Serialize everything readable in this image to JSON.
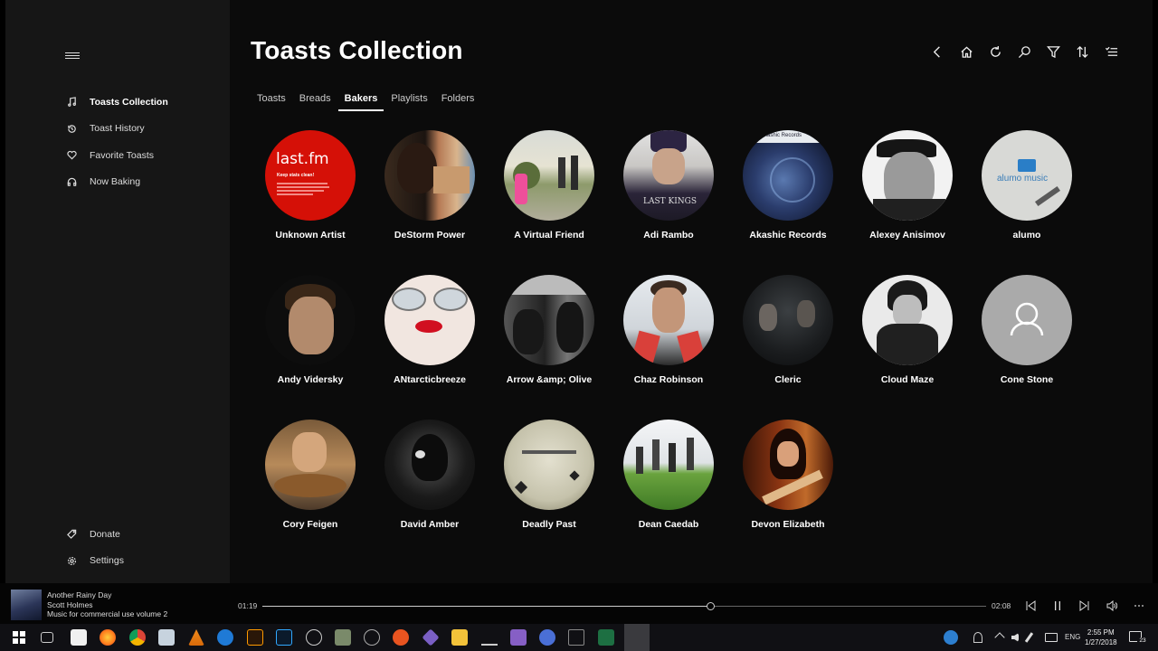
{
  "sidebar": {
    "nav": [
      {
        "label": "Toasts Collection",
        "icon": "music-note-icon"
      },
      {
        "label": "Toast History",
        "icon": "history-icon"
      },
      {
        "label": "Favorite Toasts",
        "icon": "heart-icon"
      },
      {
        "label": "Now Baking",
        "icon": "headphones-icon"
      }
    ],
    "bottom": [
      {
        "label": "Donate",
        "icon": "tag-icon"
      },
      {
        "label": "Settings",
        "icon": "gear-icon"
      }
    ]
  },
  "main": {
    "title": "Toasts Collection",
    "toolbar": [
      "back-icon",
      "home-icon",
      "refresh-icon",
      "search-icon",
      "filter-icon",
      "sort-icon",
      "select-icon"
    ],
    "tabs": [
      "Toasts",
      "Breads",
      "Bakers",
      "Playlists",
      "Folders"
    ],
    "active_tab": "Bakers",
    "bakers": [
      {
        "name": "Unknown Artist"
      },
      {
        "name": "DeStorm Power"
      },
      {
        "name": "A Virtual Friend"
      },
      {
        "name": "Adi Rambo"
      },
      {
        "name": "Akashic Records"
      },
      {
        "name": "Alexey Anisimov"
      },
      {
        "name": "alumo"
      },
      {
        "name": "Andy Vidersky"
      },
      {
        "name": "ANtarcticbreeze"
      },
      {
        "name": "Arrow &amp; Olive"
      },
      {
        "name": "Chaz Robinson"
      },
      {
        "name": "Cleric"
      },
      {
        "name": "Cloud Maze"
      },
      {
        "name": "Cone Stone"
      },
      {
        "name": "Cory Feigen"
      },
      {
        "name": "David Amber"
      },
      {
        "name": "Deadly Past"
      },
      {
        "name": "Dean Caedab"
      },
      {
        "name": "Devon Elizabeth"
      }
    ],
    "art_text": {
      "lastfm_logo": "last.fm",
      "lastfm_sub": "Keep stats clean!",
      "alumo_logo": "alumo music",
      "lastkings": "LAST KINGS",
      "akashic": "Akashic Records"
    }
  },
  "player": {
    "track": "Another Rainy Day",
    "artist": "Scott Holmes",
    "album": "Music for commercial use volume 2",
    "elapsed": "01:19",
    "total": "02:08",
    "progress": 0.62
  },
  "taskbar": {
    "lang": "ENG",
    "time": "2:55 PM",
    "date": "1/27/2018",
    "notifications": "23"
  },
  "colors": {
    "sidebar_bg": "#161616",
    "main_bg": "#0b0b0b",
    "accent": "#ffffff"
  }
}
